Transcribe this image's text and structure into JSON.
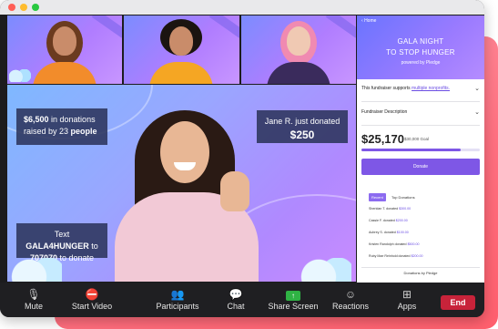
{
  "panel": {
    "home": "Home",
    "hero_line1": "GALA NIGHT",
    "hero_line2": "TO STOP HUNGER",
    "hero_powered": "powered by Pledge",
    "supports_prefix": "This fundraiser supports",
    "supports_link": "multiple nonprofits.",
    "description_label": "Fundraiser Description",
    "amount": "$25,170",
    "goal": "$30,000 Goal",
    "progress_fraction": 0.84,
    "donate_label": "Donate",
    "tab_recent": "Recent",
    "tab_top": "Top Donations",
    "donations": [
      {
        "text": "Sheridan T. donated",
        "amount": "$300.00"
      },
      {
        "text": "Cassie F. donated",
        "amount": "$200.00"
      },
      {
        "text": "Aubrey S. donated",
        "amount": "$100.00"
      },
      {
        "text": "Kristen Randolph donated",
        "amount": "$500.00"
      },
      {
        "text": "Ruby Mae Reinhold donated",
        "amount": "$200.00"
      }
    ],
    "footer": "Donations by Pledge"
  },
  "main": {
    "callout1_amount": "$6,500",
    "callout1_mid": " in donations raised by 23 ",
    "callout1_people": "people",
    "callout2_name": "Jane R. just donated",
    "callout2_amount": "$250",
    "callout3_prefix": "Text ",
    "callout3_code": "GALA4HUNGER",
    "callout3_mid": " to ",
    "callout3_number": "707070",
    "callout3_suffix": " to donate"
  },
  "toolbar": {
    "mute": "Mute",
    "video": "Start Video",
    "participants": "Participants",
    "chat": "Chat",
    "share": "Share Screen",
    "reactions": "Reactions",
    "apps": "Apps",
    "end": "End"
  }
}
